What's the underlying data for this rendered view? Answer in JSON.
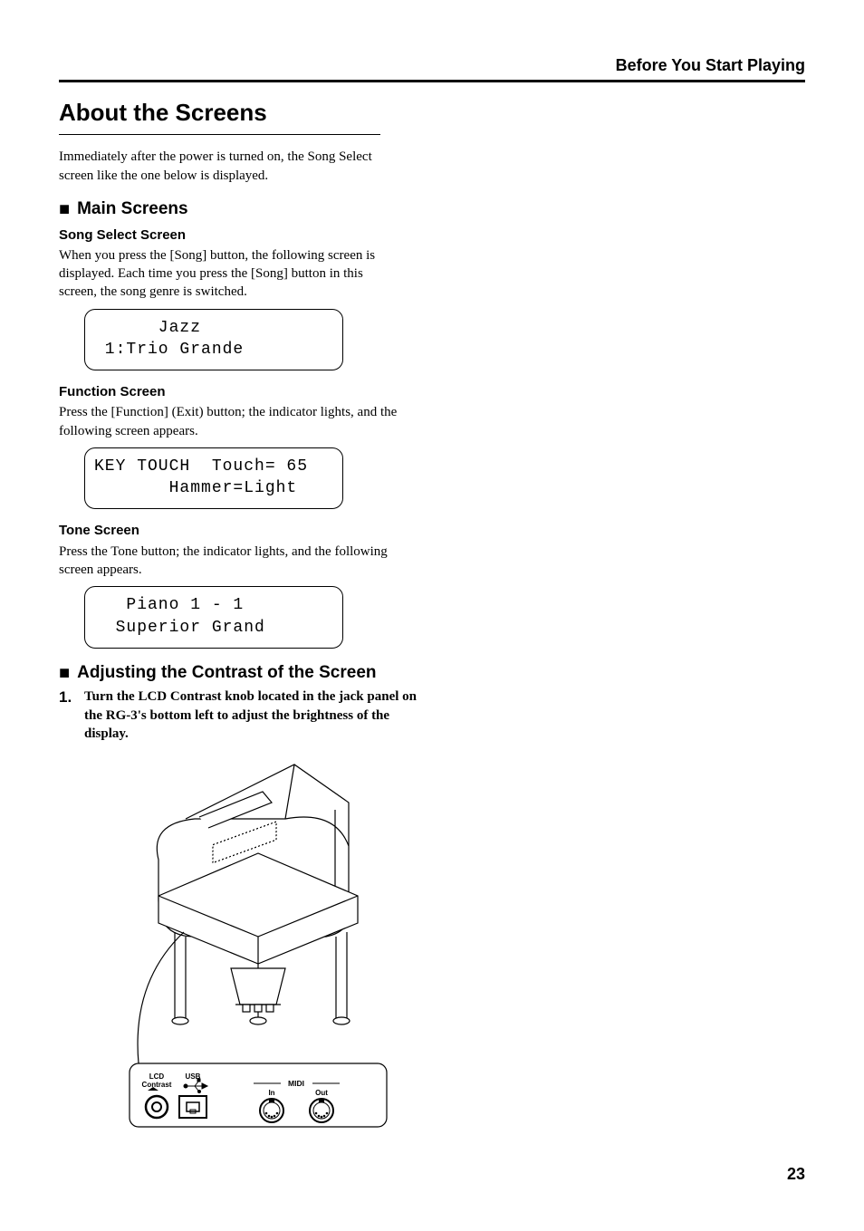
{
  "header": "Before You Start Playing",
  "section_title": "About the Screens",
  "intro": "Immediately after the power is turned on, the Song Select screen like the one below is displayed.",
  "main_screens": {
    "heading": "Main Screens",
    "song_select": {
      "title": "Song Select Screen",
      "body": "When you press the [Song] button, the following screen is displayed. Each time you press the [Song] button in this screen, the song genre is switched.",
      "lcd_line1": "      Jazz",
      "lcd_line2": " 1:Trio Grande"
    },
    "function": {
      "title": "Function Screen",
      "body": "Press the [Function] (Exit) button; the indicator lights, and the following screen appears.",
      "lcd_line1": "KEY TOUCH  Touch= 65",
      "lcd_line2": "       Hammer=Light"
    },
    "tone": {
      "title": "Tone Screen",
      "body": "Press the Tone button; the indicator lights, and the following screen appears.",
      "lcd_line1": "   Piano 1 - 1",
      "lcd_line2": "  Superior Grand"
    }
  },
  "adjusting": {
    "heading": "Adjusting the Contrast of the Screen",
    "step1_num": "1.",
    "step1_text": "Turn the LCD Contrast knob located in the jack panel on the RG-3's bottom left to adjust the brightness of the display."
  },
  "panel_labels": {
    "lcd": "LCD",
    "contrast": "Contrast",
    "usb": "USB",
    "midi": "MIDI",
    "in": "In",
    "out": "Out"
  },
  "page_number": "23"
}
